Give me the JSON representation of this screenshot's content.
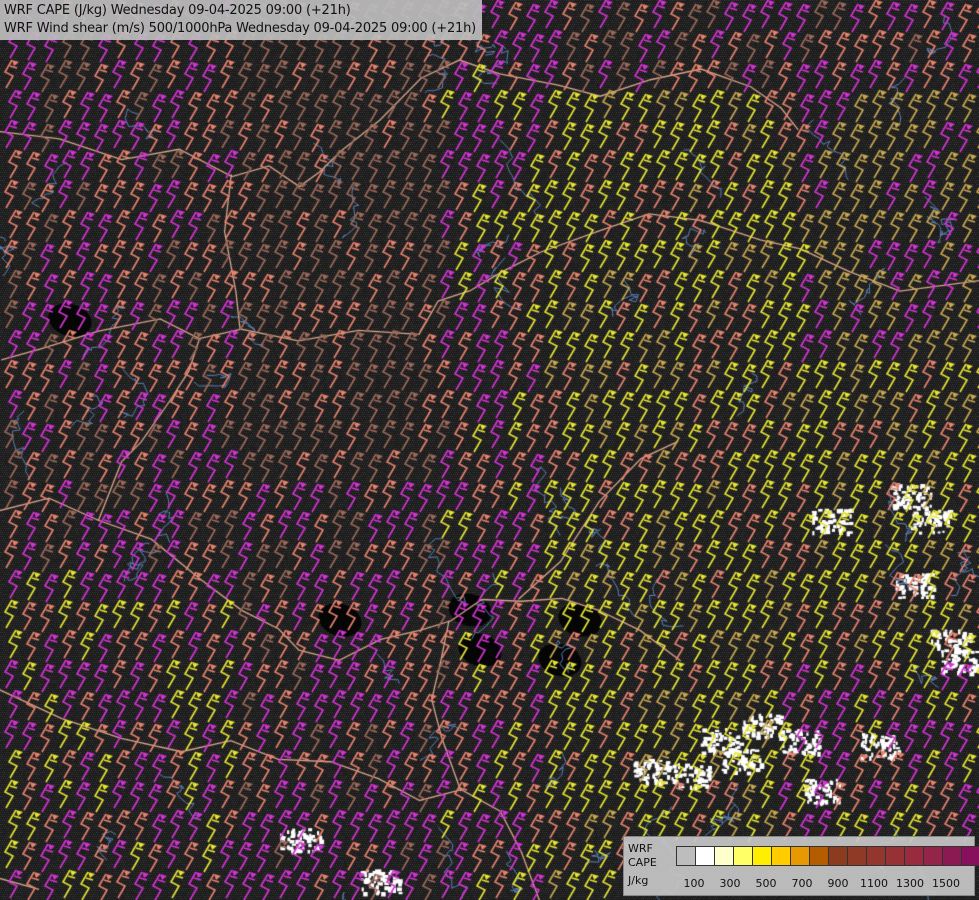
{
  "title": {
    "line1": "WRF CAPE (J/kg) Wednesday 09-04-2025 09:00 (+21h)",
    "line2": "WRF Wind shear (m/s) 500/1000hPa Wednesday 09-04-2025 09:00 (+21h)"
  },
  "legend": {
    "label_line1": "WRF",
    "label_line2": "CAPE",
    "label_line3": "J/kg",
    "colors": [
      "#bdbdbd",
      "#ffffff",
      "#ffffcc",
      "#ffff66",
      "#ffee00",
      "#ffcc00",
      "#e69900",
      "#b35c00",
      "#8c3c1e",
      "#8e3a26",
      "#93372e",
      "#963236",
      "#982b3e",
      "#922548",
      "#8c1a52",
      "#86105c",
      "#800066",
      "#880c70"
    ],
    "ticks": [
      "100",
      "300",
      "500",
      "700",
      "900",
      "1100",
      "1300",
      "1500"
    ]
  },
  "map_palette": {
    "background": "#1b1b1b",
    "border_color": "#d9a68c",
    "coast_color": "#5a7fb3",
    "barb_magenta": "#d633d6",
    "barb_salmon": "#e8836f",
    "barb_brown": "#9c6a5a",
    "barb_yellow": "#e6e633",
    "barb_khaki": "#c8a850",
    "cape_white": "#ffffff"
  }
}
